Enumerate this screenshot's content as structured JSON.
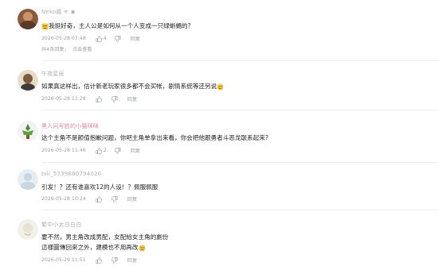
{
  "comments": [
    {
      "username": "Neko酱 ≋ ◉",
      "prefix_emoji": "think-emoji",
      "text": "我挺好奇，主人公是如何从一个人变成一只绿蜥蜴的？",
      "time": "2026-05-28 07:48",
      "likes": "4",
      "reply_label": "回复",
      "replies_count": "共4条回复，",
      "replies_more": "点击查看"
    },
    {
      "username": "午夜星辰",
      "text": "如果真这样出，估计新老玩家很多都不会买帐，剧情系统等还另说",
      "suffix_emoji": "sweat-emoji",
      "time": "2026-05-28 11:28",
      "likes": "",
      "reply_label": "回复"
    },
    {
      "username": "黑人问号脸的小猫咪咪",
      "text": "这个主角不是颜值抱歉问题，你吧主角单拿出来看，你会把他跟勇者斗恶龙联系起来?",
      "time": "2026-05-28 11:46",
      "likes": "2",
      "reply_label": "回复"
    },
    {
      "username": "bili_5739880794020",
      "text": "引发！？还有谁喜欢12的人设！？佩服佩服",
      "time": "2026-05-28 10:24",
      "likes": "",
      "reply_label": "回复"
    },
    {
      "username": "繁中小太白白白",
      "text_line1": "要不然，男主角改成男配，女配給女主角的劇份",
      "text_line2": "這樣圖傳回來之外，建模也不用再改",
      "suffix_emoji": "sweat-emoji",
      "time": "2026-05-29 11:51",
      "likes": "",
      "reply_label": "回复"
    }
  ],
  "colors": {
    "text": "#222222",
    "meta": "#9aa0a6",
    "username": "#b0b0b0",
    "divider": "#eceef0",
    "emoji": "#f5c842"
  }
}
